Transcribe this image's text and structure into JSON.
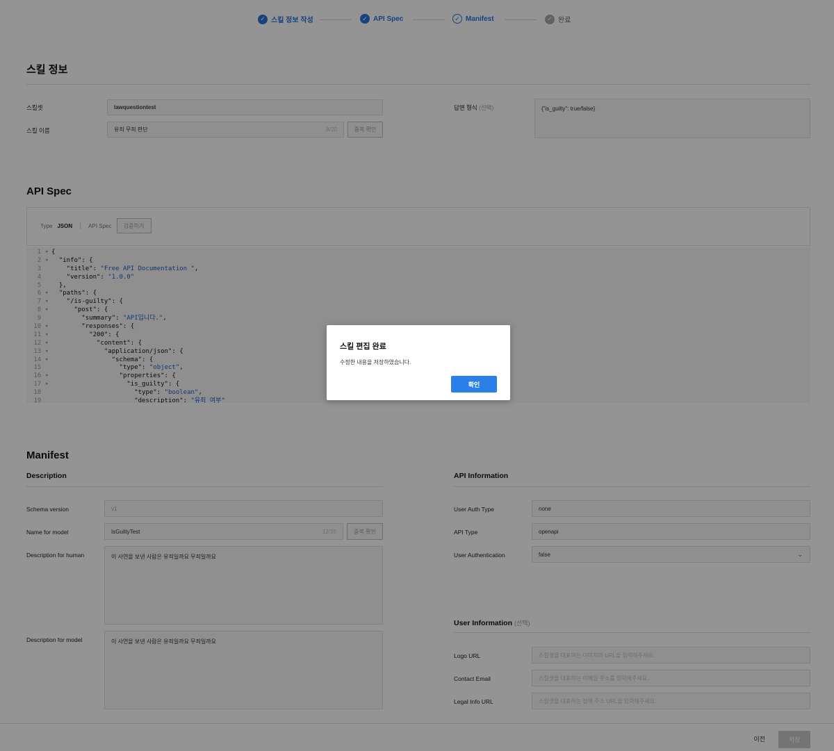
{
  "stepper": {
    "steps": [
      {
        "label": "스킬 정보 작성",
        "state": "completed",
        "icon": "check-icon"
      },
      {
        "label": "API Spec",
        "state": "completed",
        "icon": "check-icon"
      },
      {
        "label": "Manifest",
        "state": "current",
        "icon": "check-circle-outline-icon"
      },
      {
        "label": "완료",
        "state": "pending",
        "icon": "check-icon"
      }
    ]
  },
  "skill_info": {
    "title": "스킬 정보",
    "skillset_label": "스킬셋",
    "skillset_value": "lawquestiontest",
    "skill_name_label": "스킬 이름",
    "skill_name_value": "유죄 무죄 판단",
    "skill_name_counter": "8/20",
    "dup_check_label": "중복 확인",
    "answer_format_label": "답변 형식",
    "answer_format_optional": "(선택)",
    "answer_format_value": "{\"is_guilty\": true/false}"
  },
  "api_spec": {
    "title": "API Spec",
    "type_label": "Type",
    "type_value": "JSON",
    "spec_label": "API Spec",
    "validate_label": "검증하기",
    "code_lines": [
      "{",
      "  \"info\": {",
      "    \"title\": \"Free API Documentation \",",
      "    \"version\": \"1.0.0\"",
      "  },",
      "  \"paths\": {",
      "    \"/is-guilty\": {",
      "      \"post\": {",
      "        \"summary\": \"API입니다.\",",
      "        \"responses\": {",
      "          \"200\": {",
      "            \"content\": {",
      "              \"application/json\": {",
      "                \"schema\": {",
      "                  \"type\": \"object\",",
      "                  \"properties\": {",
      "                    \"is_guilty\": {",
      "                      \"type\": \"boolean\",",
      "                      \"description\": \"유죄 여부\""
    ],
    "line_numbers": [
      "1",
      "2",
      "3",
      "4",
      "5",
      "6",
      "7",
      "8",
      "9",
      "10",
      "11",
      "12",
      "13",
      "14",
      "15",
      "16",
      "17",
      "18",
      "19"
    ],
    "fold_lines": [
      1,
      2,
      6,
      7,
      8,
      10,
      11,
      12,
      13,
      14,
      16,
      17
    ]
  },
  "manifest": {
    "title": "Manifest",
    "description": {
      "title": "Description",
      "schema_version_label": "Schema version",
      "schema_version_value": "v1",
      "name_for_model_label": "Name for model",
      "name_for_model_value": "IsGuiltyTest",
      "name_for_model_counter": "12/20",
      "dup_check_label": "중복 확인",
      "desc_human_label": "Description for human",
      "desc_human_value": "이 사연을 보낸 사람은 유죄일까요 무죄일까요",
      "desc_model_label": "Description for model",
      "desc_model_value": "이 사연을 보낸 사람은 유죄일까요 무죄일까요"
    },
    "api_information": {
      "title": "API Information",
      "auth_type_label": "User Auth Type",
      "auth_type_value": "none",
      "api_type_label": "API Type",
      "api_type_value": "openapi",
      "user_auth_label": "User Authentication",
      "user_auth_value": "false"
    },
    "user_information": {
      "title": "User Information",
      "optional": "(선택)",
      "logo_label": "Logo URL",
      "logo_placeholder": "스킬셋을 대표하는 이미지의 URL을 입력해주세요.",
      "email_label": "Contact Email",
      "email_placeholder": "스킬셋을 대표하는 이메일 주소를 입력해주세요.",
      "legal_label": "Legal Info URL",
      "legal_placeholder": "스킬셋을 대표하는 정책 주소 URL을 입력해주세요."
    }
  },
  "footer": {
    "prev_label": "이전",
    "save_label": "저장"
  },
  "modal": {
    "title": "스킬 편집 완료",
    "message": "수정한 내용을 저장하였습니다.",
    "confirm_label": "확인"
  },
  "colors": {
    "accent": "#2a73d8",
    "modal_button": "#2a7fe8",
    "overlay": "rgba(0,0,0,0.42)",
    "code_string": "#1a5fc7"
  }
}
